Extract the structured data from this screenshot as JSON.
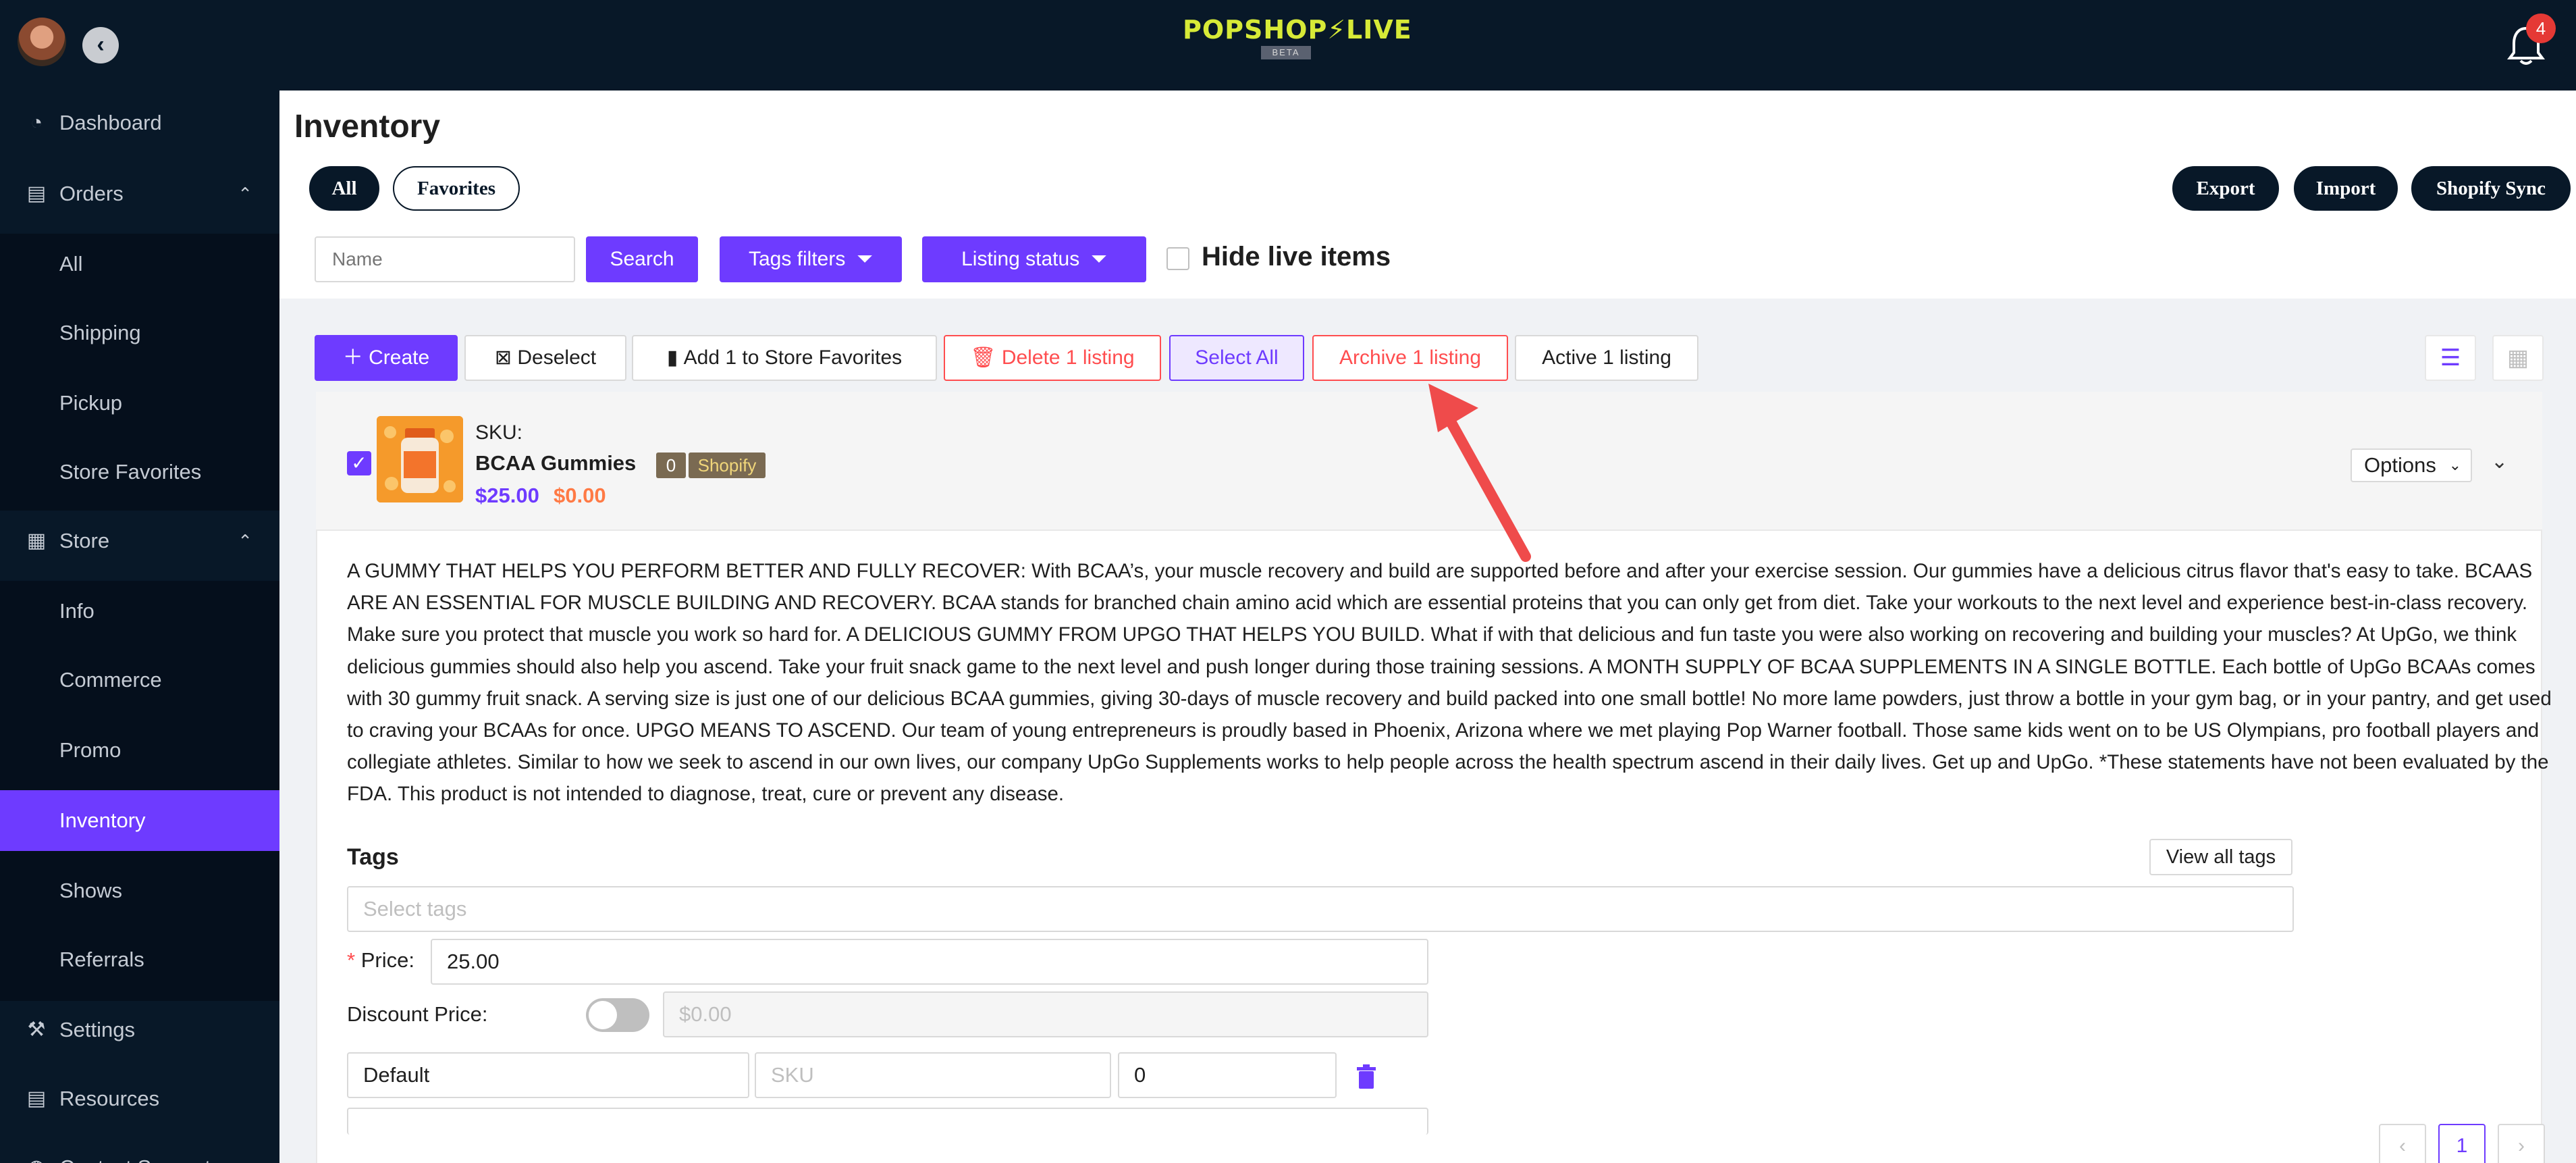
{
  "topbar": {
    "logo": "POPSHOP⚡LIVE",
    "logo_beta": "BETA",
    "notification_count": "4"
  },
  "sidebar": {
    "items": [
      {
        "label": "Dashboard",
        "icon": "dashboard-icon"
      },
      {
        "label": "Orders",
        "icon": "orders-icon"
      },
      {
        "label": "All"
      },
      {
        "label": "Shipping"
      },
      {
        "label": "Pickup"
      },
      {
        "label": "Store Favorites"
      },
      {
        "label": "Store",
        "icon": "store-icon"
      },
      {
        "label": "Info"
      },
      {
        "label": "Commerce"
      },
      {
        "label": "Promo"
      },
      {
        "label": "Inventory"
      },
      {
        "label": "Shows"
      },
      {
        "label": "Referrals"
      },
      {
        "label": "Settings",
        "icon": "settings-icon"
      },
      {
        "label": "Resources",
        "icon": "resources-icon"
      },
      {
        "label": "Contact Support",
        "icon": "support-icon"
      }
    ],
    "active": "Inventory",
    "accent_color": "#6e3bff"
  },
  "main": {
    "title": "Inventory",
    "filter_tabs": [
      "All",
      "Favorites"
    ],
    "actions": [
      "Export",
      "Import",
      "Shopify Sync"
    ],
    "search": {
      "placeholder": "Name",
      "button": "Search",
      "tags_filter": "Tags filters",
      "listing_status": "Listing status",
      "hide_live_label": "Hide live items",
      "hide_live_checked": false
    },
    "toolbar": {
      "create": "Create",
      "deselect": "Deselect",
      "add_favorites": "Add 1 to Store Favorites",
      "delete": "Delete 1 listing",
      "select_all": "Select All",
      "archive": "Archive 1 listing",
      "active": "Active 1 listing"
    },
    "pagination": {
      "current": "1"
    }
  },
  "listing": {
    "selected": true,
    "sku_label": "SKU:",
    "name": "BCAA Gummies",
    "count_badge": "0",
    "source_badge": "Shopify",
    "price": "$25.00",
    "discount_price": "$0.00",
    "options_label": "Options",
    "description": "A GUMMY THAT HELPS YOU PERFORM BETTER AND FULLY RECOVER: With BCAA’s, your muscle recovery and build are supported before and after your exercise session. Our gummies have a delicious citrus flavor that's easy to take. BCAAS ARE AN ESSENTIAL FOR MUSCLE BUILDING AND RECOVERY. BCAA stands for branched chain amino acid which are essential proteins that you can only get from diet. Take your workouts to the next level and experience best-in-class recovery. Make sure you protect that muscle you work so hard for. A DELICIOUS GUMMY FROM UPGO THAT HELPS YOU BUILD. What if with that delicious and fun taste you were also working on recovering and building your muscles? At UpGo, we think delicious gummies should also help you ascend. Take your fruit snack game to the next level and push longer during those training sessions. A MONTH SUPPLY OF BCAA SUPPLEMENTS IN A SINGLE BOTTLE. Each bottle of UpGo BCAAs comes with 30 gummy fruit snack. A serving size is just one of our delicious BCAA gummies, giving 30-days of muscle recovery and build packed into one small bottle! No more lame powders, just throw a bottle in your gym bag, or in your pantry, and get used to craving your BCAAs for once. UPGO MEANS TO ASCEND. Our team of young entrepreneurs is proudly based in Phoenix, Arizona where we met playing Pop Warner football. Those same kids went on to be US Olympians, pro football players and collegiate athletes. Similar to how we seek to ascend in our own lives, our company UpGo Supplements works to help people across the health spectrum ascend in their daily lives. Get up and UpGo. *These statements have not been evaluated by the FDA. This product is not intended to diagnose, treat, cure or prevent any disease.",
    "tags_title": "Tags",
    "view_all_tags": "View all tags",
    "tags_placeholder": "Select tags",
    "price_label": "Price",
    "price_value": "25.00",
    "discount_label": "Discount Price",
    "discount_enabled": false,
    "discount_placeholder": "$0.00",
    "variant": {
      "name": "Default",
      "sku_placeholder": "SKU",
      "quantity": "0"
    }
  }
}
